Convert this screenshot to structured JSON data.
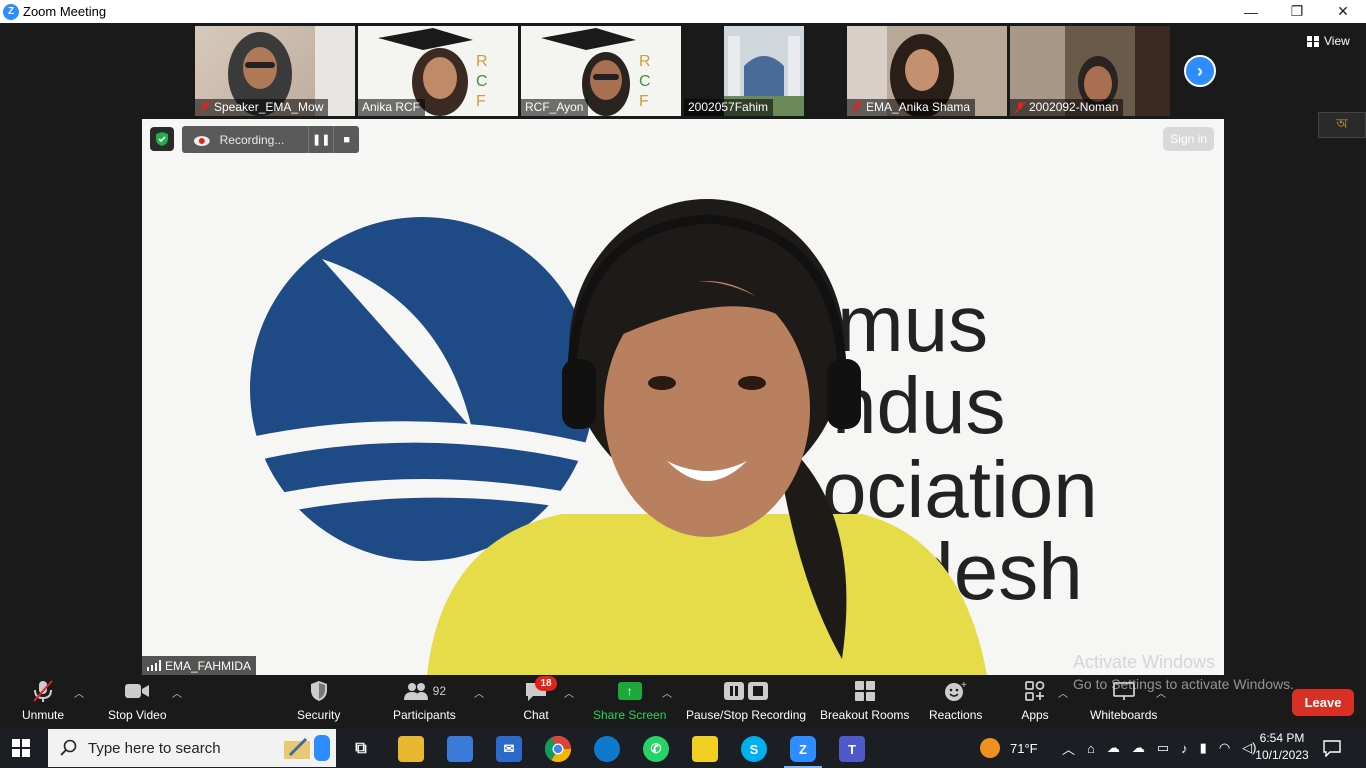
{
  "window": {
    "title": "Zoom Meeting",
    "logo_letter": "Z",
    "minimize": "—",
    "restore": "❐",
    "close": "✕"
  },
  "strip": {
    "participants": [
      {
        "name": "Speaker_EMA_Mow",
        "muted": true
      },
      {
        "name": "Anika RCF",
        "muted": false
      },
      {
        "name": "RCF_Ayon",
        "muted": false
      },
      {
        "name": "2002057Fahim",
        "muted": false
      },
      {
        "name": "EMA_Anika Shama",
        "muted": true
      },
      {
        "name": "2002092-Noman",
        "muted": true
      }
    ],
    "next_arrow": "›",
    "view_label": "View",
    "lang_indicator": "অ"
  },
  "main": {
    "speaker_name": "EMA_FAHMIDA",
    "recording_label": "Recording...",
    "pause_glyph": "❚❚",
    "stop_glyph": "■",
    "sign_in": "Sign in",
    "background_text": [
      "mus",
      "ndus",
      "ociation",
      "ladesh"
    ]
  },
  "watermark": {
    "line1": "Activate Windows",
    "line2": "Go to Settings to activate Windows."
  },
  "toolbar": {
    "unmute": "Unmute",
    "stop_video": "Stop Video",
    "security": "Security",
    "participants": "Participants",
    "participants_count": "92",
    "chat": "Chat",
    "chat_badge": "18",
    "share_screen": "Share Screen",
    "recording": "Pause/Stop Recording",
    "breakout": "Breakout Rooms",
    "reactions": "Reactions",
    "apps": "Apps",
    "whiteboards": "Whiteboards",
    "leave": "Leave"
  },
  "taskbar": {
    "search_placeholder": "Type here to search",
    "weather": "71°F",
    "time": "6:54 PM",
    "date": "10/1/2023"
  },
  "colors": {
    "zoom_blue": "#2d8cff",
    "share_green": "#1ca83a",
    "leave_red": "#d93025",
    "logo_navy": "#1e4a86"
  }
}
